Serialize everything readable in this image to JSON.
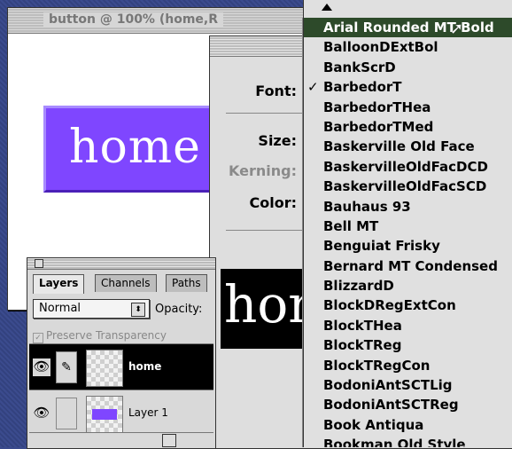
{
  "document": {
    "title": "button @ 100% (home,R",
    "button_text": "home"
  },
  "type_dialog": {
    "font_label": "Font:",
    "size_label": "Size:",
    "kerning_label": "Kerning:",
    "color_label": "Color:",
    "preview_text": "hon"
  },
  "layers_panel": {
    "tabs": [
      "Layers",
      "Channels",
      "Paths"
    ],
    "blend_mode": "Normal",
    "opacity_label": "Opacity:",
    "preserve_transparency": "Preserve Transparency",
    "layers": [
      {
        "name": "home",
        "selected": true
      },
      {
        "name": "Layer 1",
        "selected": false
      }
    ]
  },
  "font_menu": {
    "checked": "BarbedorT",
    "highlighted": "Arial Rounded MT Bold",
    "items": [
      "Arial Rounded MT Bold",
      "BalloonDExtBol",
      "BankScrD",
      "BarbedorT",
      "BarbedorTHea",
      "BarbedorTMed",
      "Baskerville Old Face",
      "BaskervilleOldFacDCD",
      "BaskervilleOldFacSCD",
      "Bauhaus 93",
      "Bell MT",
      "Benguiat Frisky",
      "Bernard MT Condensed",
      "BlizzardD",
      "BlockDRegExtCon",
      "BlockTHea",
      "BlockTReg",
      "BlockTRegCon",
      "BodoniAntSCTLig",
      "BodoniAntSCTReg",
      "Book Antiqua",
      "Bookman Old Style"
    ]
  },
  "colors": {
    "button_fill": "#7f46ff",
    "menu_highlight": "#2d4a2a"
  }
}
